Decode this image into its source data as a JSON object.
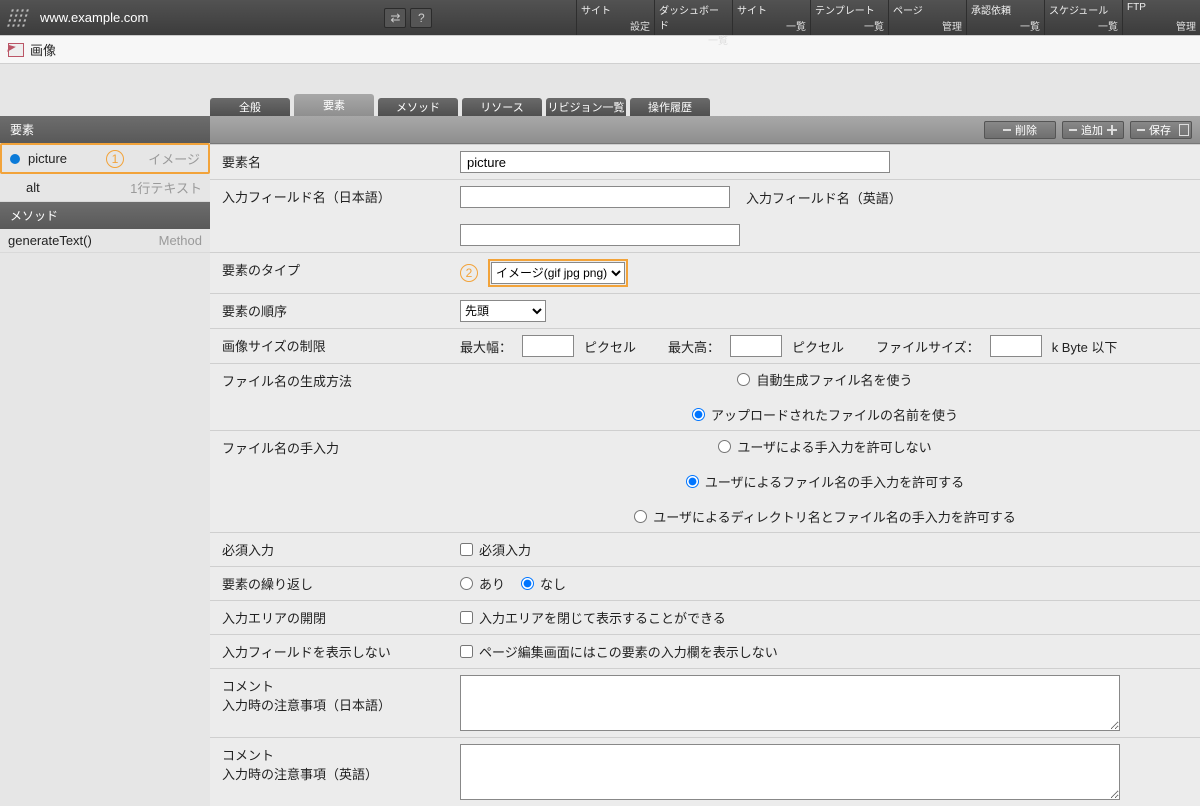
{
  "topbar": {
    "url": "www.example.com",
    "nav": [
      {
        "label": "サイト",
        "sub": "設定"
      },
      {
        "label": "ダッシュボード",
        "sub": "一覧"
      },
      {
        "label": "サイト",
        "sub": "一覧"
      },
      {
        "label": "テンプレート",
        "sub": "一覧"
      },
      {
        "label": "ページ",
        "sub": "管理"
      },
      {
        "label": "承認依頼",
        "sub": "一覧"
      },
      {
        "label": "スケジュール",
        "sub": "一覧"
      },
      {
        "label": "FTP",
        "sub": "管理"
      }
    ]
  },
  "crumb": {
    "title": "画像"
  },
  "tabs": [
    "全般",
    "要素",
    "メソッド",
    "リソース",
    "リビジョン一覧",
    "操作履歴"
  ],
  "active_tab": "要素",
  "toolbar": {
    "delete": "削除",
    "add": "追加",
    "save": "保存"
  },
  "sidebar": {
    "head_elements": "要素",
    "items": [
      {
        "name": "picture",
        "type": "イメージ",
        "active": true
      },
      {
        "name": "alt",
        "type": "1行テキスト",
        "active": false
      }
    ],
    "head_methods": "メソッド",
    "methods": [
      {
        "name": "generateText()",
        "type": "Method"
      }
    ],
    "callout1": "1"
  },
  "form": {
    "elem_name_label": "要素名",
    "elem_name_value": "picture",
    "field_jp_label": "入力フィールド名（日本語）",
    "field_jp_value": "",
    "field_en_label": "入力フィールド名（英語）",
    "field_en_value": "",
    "type_label": "要素のタイプ",
    "type_value": "イメージ(gif jpg png)",
    "callout2": "2",
    "order_label": "要素の順序",
    "order_value": "先頭",
    "size_label": "画像サイズの制限",
    "max_w_label": "最大幅：",
    "max_w_unit": "ピクセル",
    "max_h_label": "最大高：",
    "max_h_unit": "ピクセル",
    "fsize_label": "ファイルサイズ：",
    "fsize_unit": "k Byte 以下",
    "fngen_label": "ファイル名の生成方法",
    "fngen_auto": "自動生成ファイル名を使う",
    "fngen_upload": "アップロードされたファイルの名前を使う",
    "fnman_label": "ファイル名の手入力",
    "fnman_none": "ユーザによる手入力を許可しない",
    "fnman_file": "ユーザによるファイル名の手入力を許可する",
    "fnman_dir": "ユーザによるディレクトリ名とファイル名の手入力を許可する",
    "required_label": "必須入力",
    "required_check": "必須入力",
    "repeat_label": "要素の繰り返し",
    "repeat_yes": "あり",
    "repeat_no": "なし",
    "openclose_label": "入力エリアの開閉",
    "openclose_check": "入力エリアを閉じて表示することができる",
    "hide_label": "入力フィールドを表示しない",
    "hide_check": "ページ編集画面にはこの要素の入力欄を表示しない",
    "comment_jp_label1": "コメント",
    "comment_jp_label2": "入力時の注意事項（日本語）",
    "comment_en_label1": "コメント",
    "comment_en_label2": "入力時の注意事項（英語）"
  }
}
